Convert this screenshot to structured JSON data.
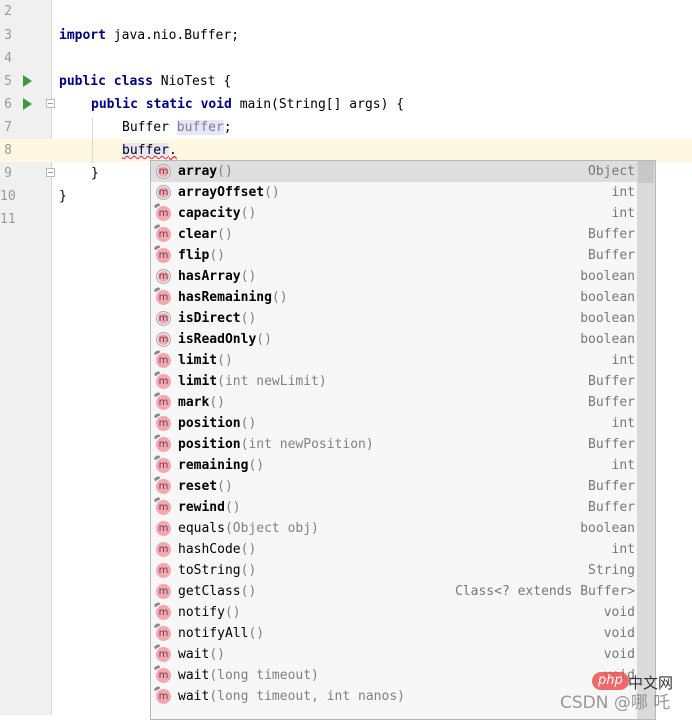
{
  "editor": {
    "line_numbers": [
      "2",
      "3",
      "4",
      "5",
      "6",
      "7",
      "8",
      "9",
      "10",
      "11"
    ],
    "code": {
      "line3_kw": "import",
      "line3_rest": " java.nio.Buffer;",
      "line5_kw": "public class",
      "line5_rest": " NioTest {",
      "line6_kw": "public static void",
      "line6_rest": " main(String[] args) {",
      "line7_type": "Buffer ",
      "line7_var": "buffer",
      "line7_end": ";",
      "line8_var": "buffer",
      "line8_dot": ".",
      "line9": "}",
      "line10": "}"
    }
  },
  "completion": {
    "selected_index": 0,
    "items": [
      {
        "name": "array",
        "params": "()",
        "type": "Object",
        "bold": true,
        "icon": "method-abstract"
      },
      {
        "name": "arrayOffset",
        "params": "()",
        "type": "int",
        "bold": true,
        "icon": "method-abstract"
      },
      {
        "name": "capacity",
        "params": "()",
        "type": "int",
        "bold": true,
        "icon": "method-inherited"
      },
      {
        "name": "clear",
        "params": "()",
        "type": "Buffer",
        "bold": true,
        "icon": "method-inherited"
      },
      {
        "name": "flip",
        "params": "()",
        "type": "Buffer",
        "bold": true,
        "icon": "method-inherited"
      },
      {
        "name": "hasArray",
        "params": "()",
        "type": "boolean",
        "bold": true,
        "icon": "method-abstract"
      },
      {
        "name": "hasRemaining",
        "params": "()",
        "type": "boolean",
        "bold": true,
        "icon": "method-inherited"
      },
      {
        "name": "isDirect",
        "params": "()",
        "type": "boolean",
        "bold": true,
        "icon": "method-abstract"
      },
      {
        "name": "isReadOnly",
        "params": "()",
        "type": "boolean",
        "bold": true,
        "icon": "method-abstract"
      },
      {
        "name": "limit",
        "params": "()",
        "type": "int",
        "bold": true,
        "icon": "method-inherited"
      },
      {
        "name": "limit",
        "params": "(int newLimit)",
        "type": "Buffer",
        "bold": true,
        "icon": "method-inherited"
      },
      {
        "name": "mark",
        "params": "()",
        "type": "Buffer",
        "bold": true,
        "icon": "method-inherited"
      },
      {
        "name": "position",
        "params": "()",
        "type": "int",
        "bold": true,
        "icon": "method-inherited"
      },
      {
        "name": "position",
        "params": "(int newPosition)",
        "type": "Buffer",
        "bold": true,
        "icon": "method-inherited"
      },
      {
        "name": "remaining",
        "params": "()",
        "type": "int",
        "bold": true,
        "icon": "method-inherited"
      },
      {
        "name": "reset",
        "params": "()",
        "type": "Buffer",
        "bold": true,
        "icon": "method-inherited"
      },
      {
        "name": "rewind",
        "params": "()",
        "type": "Buffer",
        "bold": true,
        "icon": "method-inherited"
      },
      {
        "name": "equals",
        "params": "(Object obj)",
        "type": "boolean",
        "bold": false,
        "icon": "method"
      },
      {
        "name": "hashCode",
        "params": "()",
        "type": "int",
        "bold": false,
        "icon": "method"
      },
      {
        "name": "toString",
        "params": "()",
        "type": "String",
        "bold": false,
        "icon": "method"
      },
      {
        "name": "getClass",
        "params": "()",
        "type": "Class<? extends Buffer>",
        "bold": false,
        "icon": "method"
      },
      {
        "name": "notify",
        "params": "()",
        "type": "void",
        "bold": false,
        "icon": "method-inherited"
      },
      {
        "name": "notifyAll",
        "params": "()",
        "type": "void",
        "bold": false,
        "icon": "method-inherited"
      },
      {
        "name": "wait",
        "params": "()",
        "type": "void",
        "bold": false,
        "icon": "method-inherited"
      },
      {
        "name": "wait",
        "params": "(long timeout)",
        "type": "void",
        "bold": false,
        "icon": "method-inherited"
      },
      {
        "name": "wait",
        "params": "(long timeout, int nanos)",
        "type": "",
        "bold": false,
        "icon": "method-inherited"
      }
    ],
    "icon_glyph": "m"
  },
  "watermark": {
    "csdn": "CSDN @哪 吒",
    "php": "php",
    "site": "中文网"
  }
}
